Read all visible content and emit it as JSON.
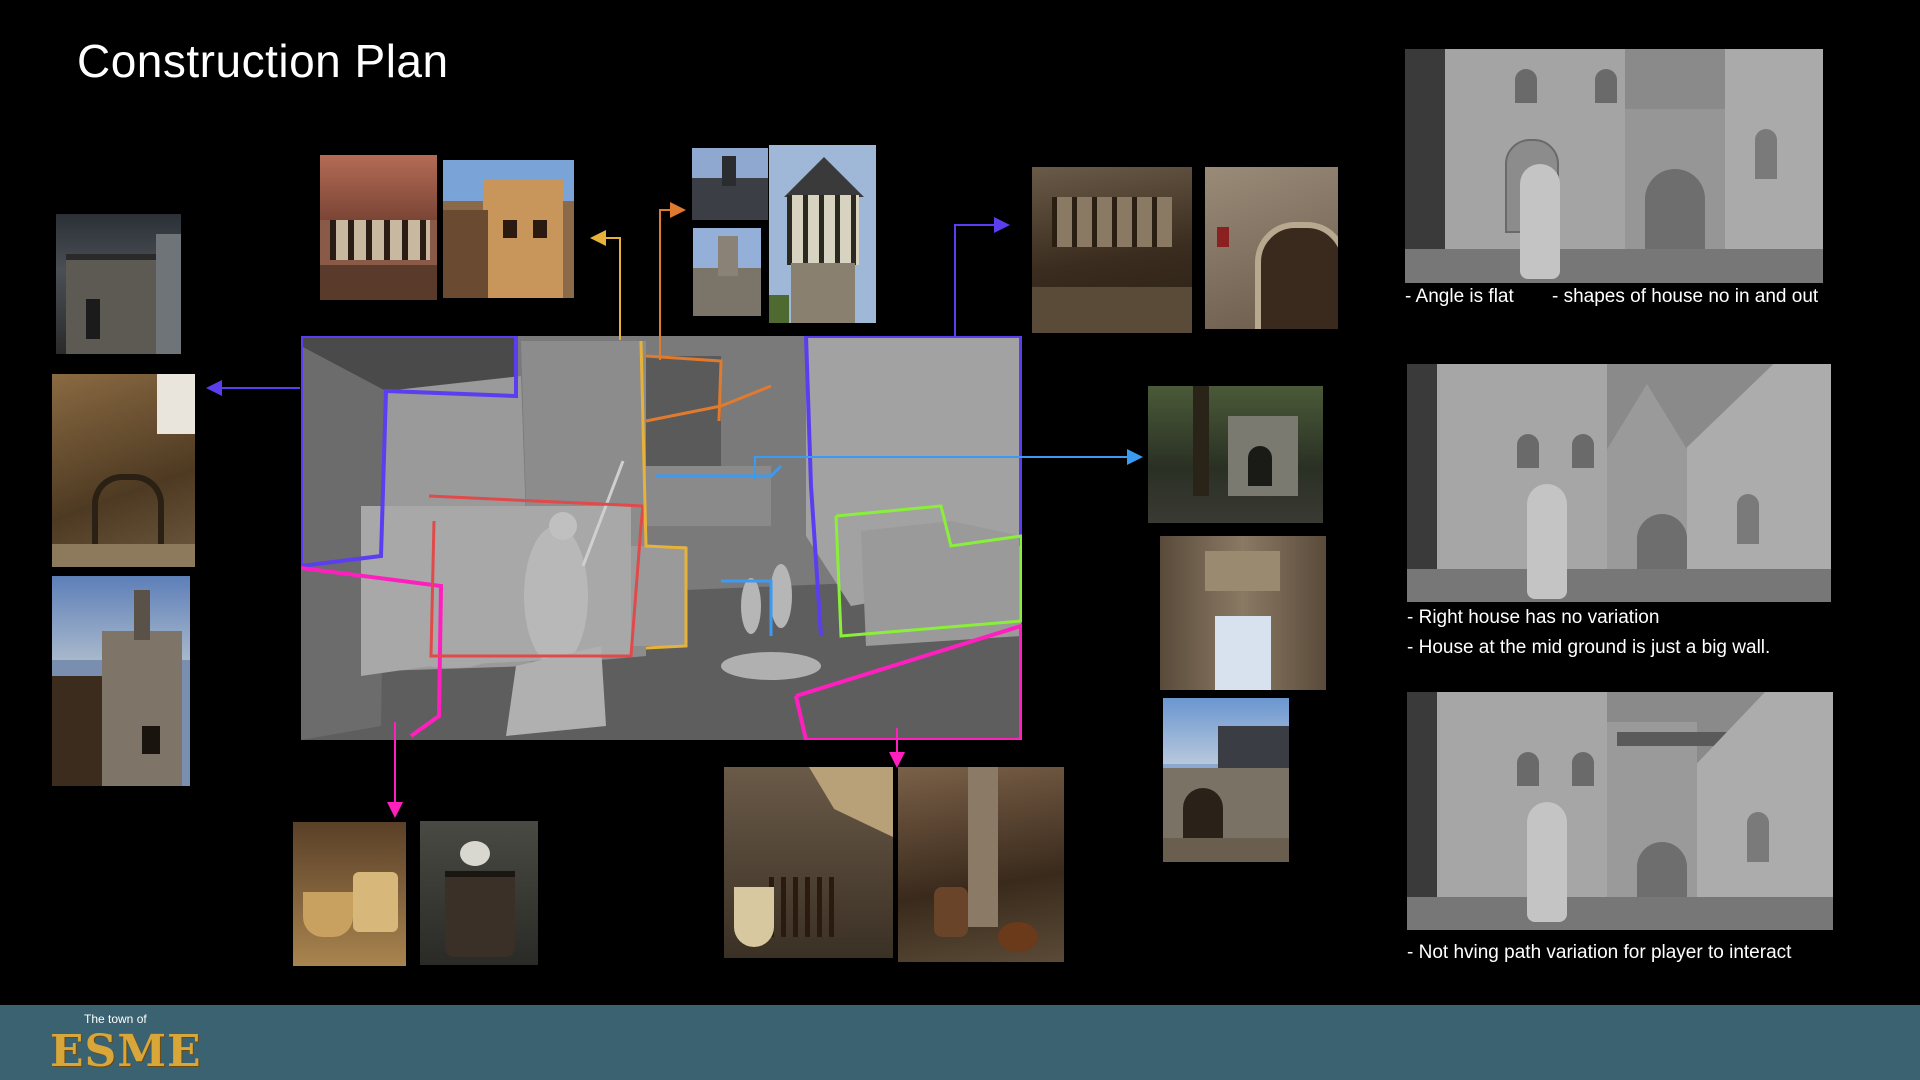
{
  "page": {
    "title": "Construction Plan"
  },
  "notes": {
    "ref1_a": "- Angle is flat",
    "ref1_b": "- shapes of house no in and out",
    "ref2_a": "- Right house has no variation",
    "ref2_b": "- House at the mid ground is just a big wall.",
    "ref3_a": "- Not hving path variation for player to interact"
  },
  "brand": {
    "small": "The town of",
    "logo": "ESME"
  },
  "colors": {
    "background": "#000000",
    "footer": "#3b6270",
    "logo": "#d9a63a",
    "outline_blue_violet": "#5b3ef0",
    "outline_magenta": "#ff1fbf",
    "outline_red": "#e04a4a",
    "outline_yellow": "#e6b23a",
    "outline_orange": "#e07a2e",
    "outline_light_blue": "#3a9bf0",
    "outline_green": "#8aef3a"
  }
}
